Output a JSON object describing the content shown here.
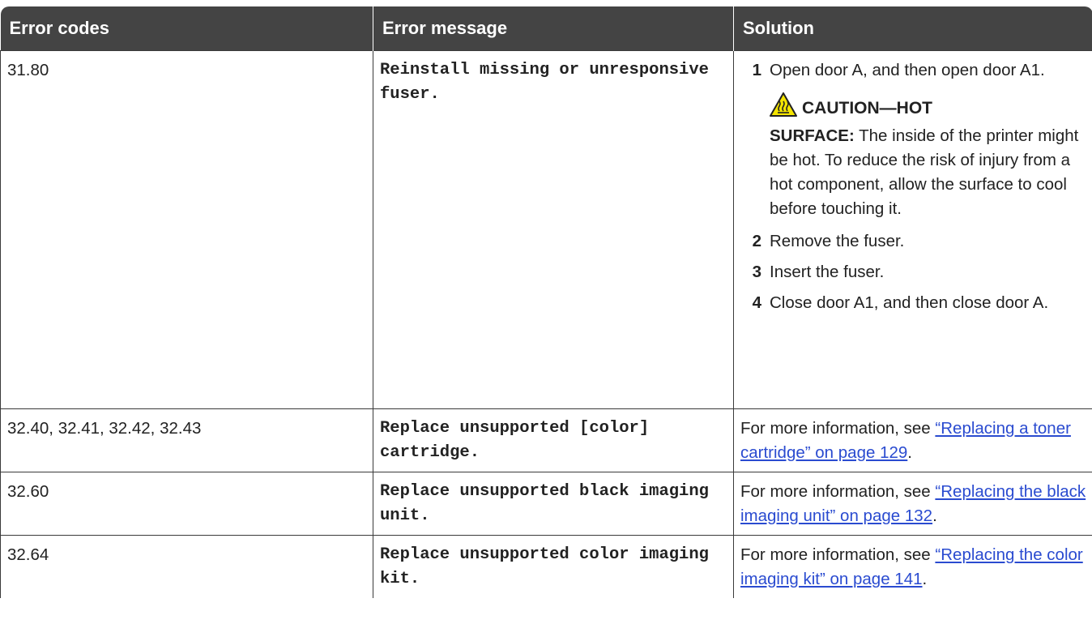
{
  "table": {
    "headers": [
      "Error codes",
      "Error message",
      "Solution"
    ],
    "rows": [
      {
        "code": "31.80",
        "message": "Reinstall missing or unresponsive fuser.",
        "steps": [
          {
            "num": "1",
            "text": "Open door A, and then open door A1."
          },
          {
            "num": "2",
            "text": "Remove the fuser."
          },
          {
            "num": "3",
            "text": "Insert the fuser."
          },
          {
            "num": "4",
            "text": "Close door A1, and then close door A."
          }
        ],
        "caution": {
          "icon": "hot-surface-warning-icon",
          "title": "CAUTION—HOT",
          "label": "SURFACE:",
          "text": "The inside of the printer might be hot. To reduce the risk of injury from a hot component, allow the surface to cool before touching it."
        }
      },
      {
        "code": "32.40, 32.41, 32.42, 32.43",
        "message": "Replace unsupported [color] cartridge.",
        "prefix": "For more information, see ",
        "link": "“Replacing a toner cartridge” on page 129",
        "suffix": "."
      },
      {
        "code": "32.60",
        "message": "Replace unsupported black imaging unit.",
        "prefix": "For more information, see ",
        "link": "“Replacing the black imaging unit” on page 132",
        "suffix": "."
      },
      {
        "code": "32.64",
        "message": "Replace unsupported color imaging kit.",
        "prefix": "For more information, see ",
        "link": "“Replacing the color imaging kit” on page 141",
        "suffix": "."
      }
    ]
  },
  "colors": {
    "header_bg": "#444444",
    "header_text": "#ffffff",
    "link": "#2a4bd0",
    "caution_icon_fill": "#f5e500"
  }
}
